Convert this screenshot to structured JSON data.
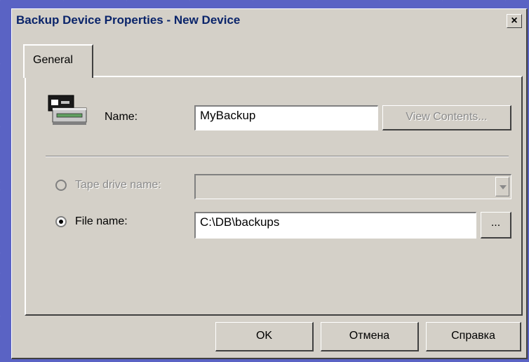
{
  "window": {
    "title": "Backup Device Properties - New Device",
    "close_label": "×"
  },
  "tabs": [
    {
      "label": "General",
      "selected": true
    }
  ],
  "device": {
    "icon": "backup-device-icon",
    "name_label": "Name:",
    "name_value": "MyBackup",
    "view_contents_label": "View Contents...",
    "view_contents_enabled": false
  },
  "destination": {
    "tape": {
      "label": "Tape drive name:",
      "selected": false,
      "enabled": false,
      "value": ""
    },
    "file": {
      "label": "File name:",
      "selected": true,
      "enabled": true,
      "value": "C:\\DB\\backups",
      "browse_label": "..."
    }
  },
  "buttons": {
    "ok": "OK",
    "cancel": "Отмена",
    "help": "Справка"
  }
}
